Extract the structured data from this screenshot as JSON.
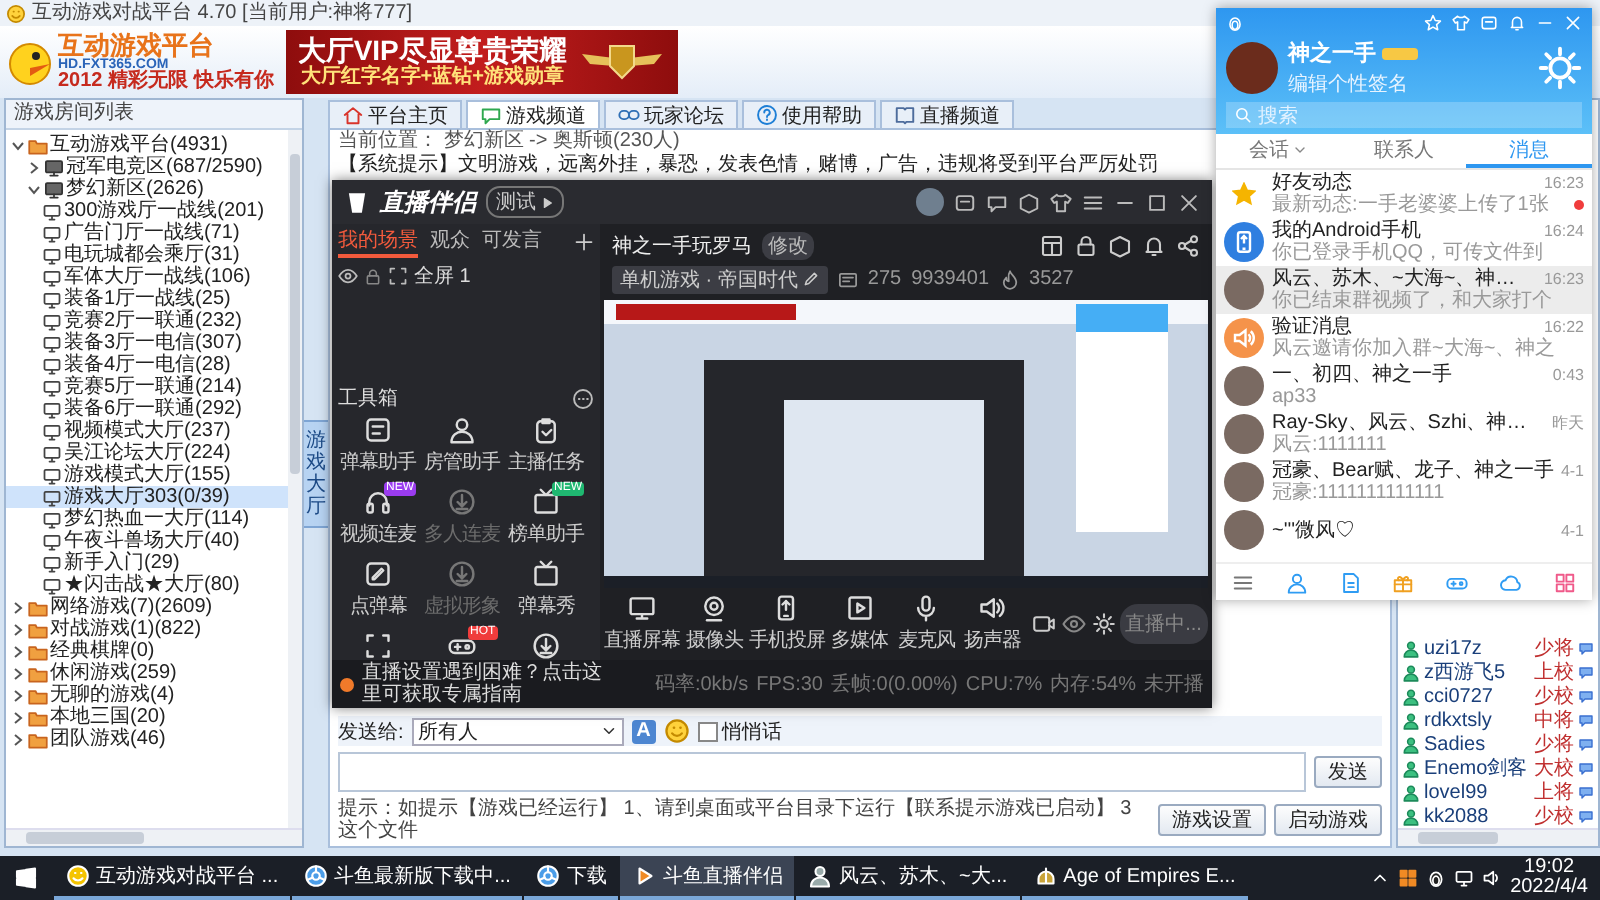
{
  "main_window": {
    "title": "互动游戏对战平台 4.70 [当前用户:神将777]",
    "logo": {
      "name": "互动游戏平台",
      "url": "HD.FXT365.COM",
      "slogan": "2012 精彩无限 快乐有你"
    },
    "banner": {
      "headline": "大厅VIP尽显尊贵荣耀",
      "subline": "大厅红字名字+蓝钻+游戏勋章"
    },
    "tabs": [
      {
        "label": "平台主页",
        "kind": "home",
        "selected": false
      },
      {
        "label": "游戏频道",
        "kind": "channel",
        "selected": true
      },
      {
        "label": "玩家论坛",
        "kind": "forum",
        "selected": false
      },
      {
        "label": "使用帮助",
        "kind": "help",
        "selected": false
      },
      {
        "label": "直播频道",
        "kind": "live",
        "selected": false
      }
    ],
    "room_panel": {
      "title": "游戏房间列表",
      "tree": [
        {
          "label": "互动游戏平台(4931)",
          "kind": "group",
          "expanded": true,
          "selected": false,
          "children": [
            {
              "label": "冠军电竞区(687/2590)",
              "kind": "zone",
              "expanded": false,
              "selected": false
            },
            {
              "label": "梦幻新区(2626)",
              "kind": "zone",
              "expanded": true,
              "selected": false,
              "children": [
                {
                  "label": "300游戏厅一战线(201)",
                  "kind": "room",
                  "selected": false
                },
                {
                  "label": "广告门厅一战线(71)",
                  "kind": "room",
                  "selected": false
                },
                {
                  "label": "电玩城都会乘厅(31)",
                  "kind": "room",
                  "selected": false
                },
                {
                  "label": "军体大厅一战线(106)",
                  "kind": "room",
                  "selected": false
                },
                {
                  "label": "装备1厅一战线(25)",
                  "kind": "room",
                  "selected": false
                },
                {
                  "label": "竞赛2厅一联通(232)",
                  "kind": "room",
                  "selected": false
                },
                {
                  "label": "装备3厅一电信(307)",
                  "kind": "room",
                  "selected": false
                },
                {
                  "label": "装备4厅一电信(28)",
                  "kind": "room",
                  "selected": false
                },
                {
                  "label": "竞赛5厅一联通(214)",
                  "kind": "room",
                  "selected": false
                },
                {
                  "label": "装备6厅一联通(292)",
                  "kind": "room",
                  "selected": false
                },
                {
                  "label": "视频模式大厅(237)",
                  "kind": "room",
                  "selected": false
                },
                {
                  "label": "吴江论坛大厅(224)",
                  "kind": "room",
                  "selected": false
                },
                {
                  "label": "游戏模式大厅(155)",
                  "kind": "room",
                  "selected": false
                },
                {
                  "label": "游戏大厅303(0/39)",
                  "kind": "room",
                  "selected": true
                },
                {
                  "label": "梦幻热血一大厅(114)",
                  "kind": "room",
                  "selected": false
                },
                {
                  "label": "午夜斗兽场大厅(40)",
                  "kind": "room",
                  "selected": false
                },
                {
                  "label": "新手入门(29)",
                  "kind": "room",
                  "selected": false
                },
                {
                  "label": "★闪击战★大厅(80)",
                  "kind": "room",
                  "selected": false
                }
              ]
            }
          ]
        },
        {
          "label": "网络游戏(7)(2609)",
          "kind": "group",
          "expanded": false,
          "selected": false
        },
        {
          "label": "对战游戏(1)(822)",
          "kind": "group",
          "expanded": false,
          "selected": false
        },
        {
          "label": "经典棋牌(0)",
          "kind": "group",
          "expanded": false,
          "selected": false
        },
        {
          "label": "休闲游戏(259)",
          "kind": "group",
          "expanded": false,
          "selected": false
        },
        {
          "label": "无聊的游戏(4)",
          "kind": "group",
          "expanded": false,
          "selected": false
        },
        {
          "label": "本地三国(20)",
          "kind": "group",
          "expanded": false,
          "selected": false
        },
        {
          "label": "团队游戏(46)",
          "kind": "group",
          "expanded": false,
          "selected": false
        }
      ]
    },
    "side_tab": "游戏大厅",
    "location": "当前位置： 梦幻新区 -> 奥斯顿(230人)",
    "notice": "【系统提示】文明游戏，远离外挂，暴恐，发表色情，赌博，广告，违规将受到平台严厉处罚",
    "send_bar": {
      "label": "发送给:",
      "recipient": "所有人",
      "font_button": "A",
      "whisper": {
        "label": "悄悄话",
        "checked": false
      },
      "send_button": "发送"
    },
    "hint": "提示：如提示【游戏已经运行】 1、请到桌面或平台目录下运行【联系提示游戏已启动】 3 这个文件",
    "buttons": [
      "游戏设置",
      "启动游戏"
    ],
    "user_list": [
      {
        "name": "uzi17z",
        "rank": "少将"
      },
      {
        "name": "z西游飞5",
        "rank": "上校"
      },
      {
        "name": "cci0727",
        "rank": "少校"
      },
      {
        "name": "rdkxtsly",
        "rank": "中将"
      },
      {
        "name": "Sadies",
        "rank": "少将"
      },
      {
        "name": "Enemo剑客",
        "rank": "大校"
      },
      {
        "name": "lovel99",
        "rank": "上将"
      },
      {
        "name": "kk2088",
        "rank": "少校"
      }
    ]
  },
  "stream_app": {
    "logo": "直播伴侣",
    "beta_tag": "测试",
    "scene_tabs": [
      {
        "label": "我的场景",
        "selected": true
      },
      {
        "label": "观众",
        "selected": false
      },
      {
        "label": "可发言",
        "selected": false
      }
    ],
    "scenes": [
      {
        "label": "全屏 1",
        "visible": true
      }
    ],
    "toolbox_title": "工具箱",
    "tools": [
      {
        "label": "弹幕助手",
        "kind": "danmu",
        "disabled": false
      },
      {
        "label": "房管助手",
        "kind": "admin",
        "disabled": false
      },
      {
        "label": "主播任务",
        "kind": "task",
        "disabled": false
      },
      {
        "label": "视频连麦",
        "kind": "video",
        "disabled": false,
        "badge": {
          "text": "NEW",
          "color": "#9b3cf0"
        }
      },
      {
        "label": "多人连麦",
        "kind": "download",
        "disabled": true
      },
      {
        "label": "榜单助手",
        "kind": "rank",
        "disabled": false,
        "badge": {
          "text": "NEW",
          "color": "#1fb871"
        }
      },
      {
        "label": "点弹幕",
        "kind": "edit",
        "disabled": false
      },
      {
        "label": "虚拟形象",
        "kind": "download",
        "disabled": true
      },
      {
        "label": "弹幕秀",
        "kind": "show",
        "disabled": false
      },
      {
        "kind": "frame",
        "disabled": false
      },
      {
        "kind": "game",
        "disabled": false,
        "badge": {
          "text": "HOT",
          "color": "#f03c3c"
        }
      },
      {
        "kind": "download",
        "disabled": false
      }
    ],
    "room": {
      "title": "神之一手玩罗马",
      "edit": "修改",
      "category": "单机游戏 · 帝国时代",
      "viewers": "275",
      "room_id": "9939401",
      "heat": "3527"
    },
    "controls": [
      {
        "label": "直播屏幕",
        "kind": "screen"
      },
      {
        "label": "摄像头",
        "kind": "camera"
      },
      {
        "label": "手机投屏",
        "kind": "phone"
      },
      {
        "label": "多媒体",
        "kind": "media"
      },
      {
        "label": "麦克风",
        "kind": "mic"
      },
      {
        "label": "扬声器",
        "kind": "speaker"
      }
    ],
    "live_button": "直播中...",
    "tip": "直播设置遇到困难？点击这里可获取专属指南",
    "stats": [
      "码率:0kb/s",
      "FPS:30",
      "丢帧:0(0.00%)",
      "CPU:7%",
      "内存:54%",
      "未开播"
    ]
  },
  "qq": {
    "nickname": "神之一手",
    "signature": "编辑个性签名",
    "search_placeholder": "搜索",
    "tabs": [
      {
        "label": "会话",
        "selected": false
      },
      {
        "label": "联系人",
        "selected": false
      },
      {
        "label": "消息",
        "selected": true
      }
    ],
    "messages": [
      {
        "name": "好友动态",
        "time": "16:23",
        "preview": "最新动态:一手老婆婆上传了1张",
        "kind": "star",
        "selected": false,
        "unread": true
      },
      {
        "name": "我的Android手机",
        "time": "16:24",
        "preview": "你已登录手机QQ，可传文件到",
        "kind": "device",
        "selected": false,
        "unread": false
      },
      {
        "name": "风云、苏木、~大海~、神…",
        "time": "16:23",
        "preview": "你已结束群视频了，和大家打个",
        "kind": "photo",
        "selected": true,
        "unread": false
      },
      {
        "name": "验证消息",
        "time": "16:22",
        "preview": "风云邀请你加入群~大海~、神之",
        "kind": "notice",
        "selected": false,
        "unread": false
      },
      {
        "name": "一、初四、神之一手",
        "time": "0:43",
        "preview": "ap33",
        "kind": "photo",
        "selected": false,
        "unread": false
      },
      {
        "name": "Ray-Sky、风云、Szhi、神…",
        "time": "昨天",
        "preview": "风云:1111111",
        "kind": "photo",
        "selected": false,
        "unread": false
      },
      {
        "name": "冠豪、Bear赋、龙子、神之一手",
        "time": "4-1",
        "preview": "冠豪:1111111111111",
        "kind": "photo",
        "selected": false,
        "unread": false
      },
      {
        "name": "~'''微风♡",
        "time": "4-1",
        "kind": "photo",
        "selected": false,
        "unread": false
      }
    ]
  },
  "taskbar": {
    "items": [
      {
        "label": "互动游戏对战平台 ...",
        "kind": "game",
        "selected": false
      },
      {
        "label": "斗鱼最新版下载中...",
        "kind": "browser",
        "selected": false
      },
      {
        "label": "下载",
        "kind": "browser",
        "selected": false
      },
      {
        "label": "斗鱼直播伴侣",
        "kind": "stream",
        "selected": true
      },
      {
        "label": "风云、苏木、~大...",
        "kind": "chat",
        "selected": false
      },
      {
        "label": "Age of Empires E...",
        "kind": "aoe",
        "selected": false
      }
    ],
    "time": "19:02",
    "date": "2022/4/4"
  }
}
